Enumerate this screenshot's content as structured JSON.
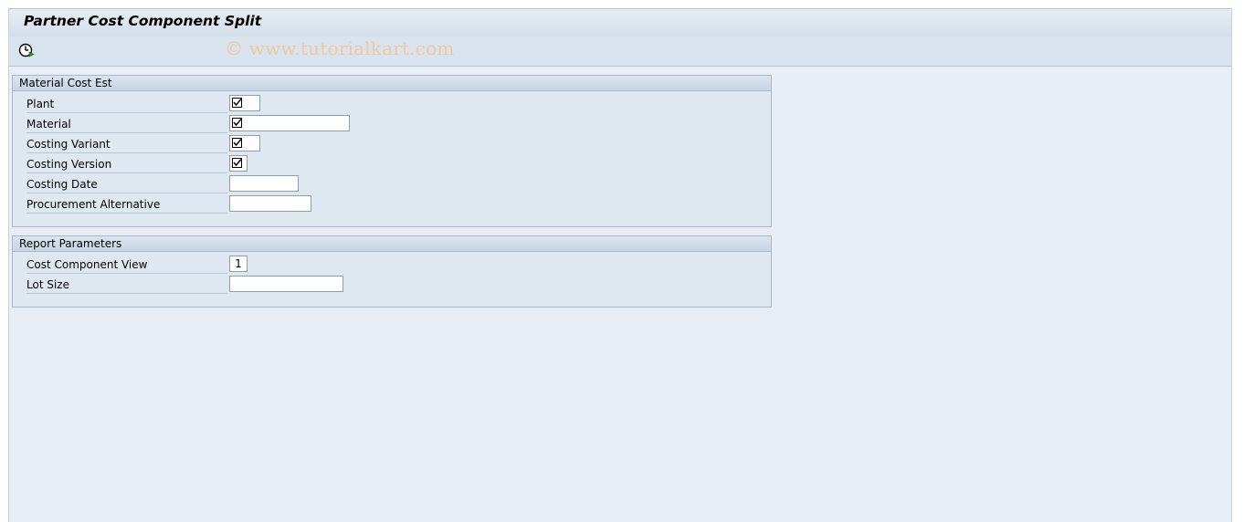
{
  "window": {
    "title": "Partner Cost Component Split"
  },
  "toolbar": {
    "execute_icon": "execute-clock-icon",
    "watermark": "© www.tutorialkart.com"
  },
  "groups": [
    {
      "title": "Material Cost Est",
      "fields": [
        {
          "label": "Plant",
          "value": "",
          "required": true
        },
        {
          "label": "Material",
          "value": "",
          "required": true
        },
        {
          "label": "Costing Variant",
          "value": "",
          "required": true
        },
        {
          "label": "Costing Version",
          "value": "",
          "required": true
        },
        {
          "label": "Costing Date",
          "value": "",
          "required": false
        },
        {
          "label": "Procurement Alternative",
          "value": "",
          "required": false
        }
      ]
    },
    {
      "title": "Report Parameters",
      "fields": [
        {
          "label": "Cost Component View",
          "value": "1",
          "required": false
        },
        {
          "label": "Lot Size",
          "value": "",
          "required": false
        }
      ]
    }
  ],
  "colors": {
    "background": "#e9eef6",
    "group_background": "#dfe8f1",
    "watermark": "#f0c9a0"
  }
}
